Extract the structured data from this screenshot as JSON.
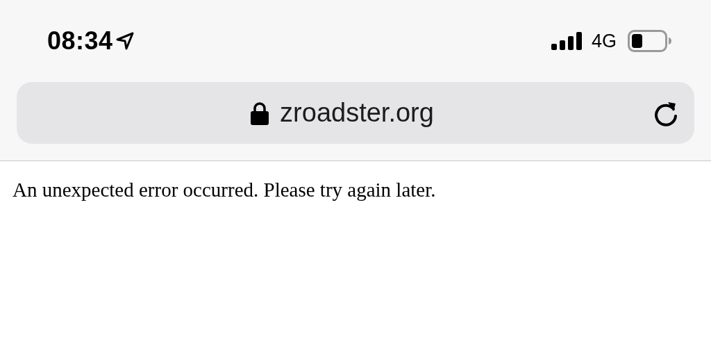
{
  "status_bar": {
    "time": "08:34",
    "network": "4G"
  },
  "address_bar": {
    "url": "zroadster.org"
  },
  "page": {
    "message": "An unexpected error occurred. Please try again later."
  }
}
